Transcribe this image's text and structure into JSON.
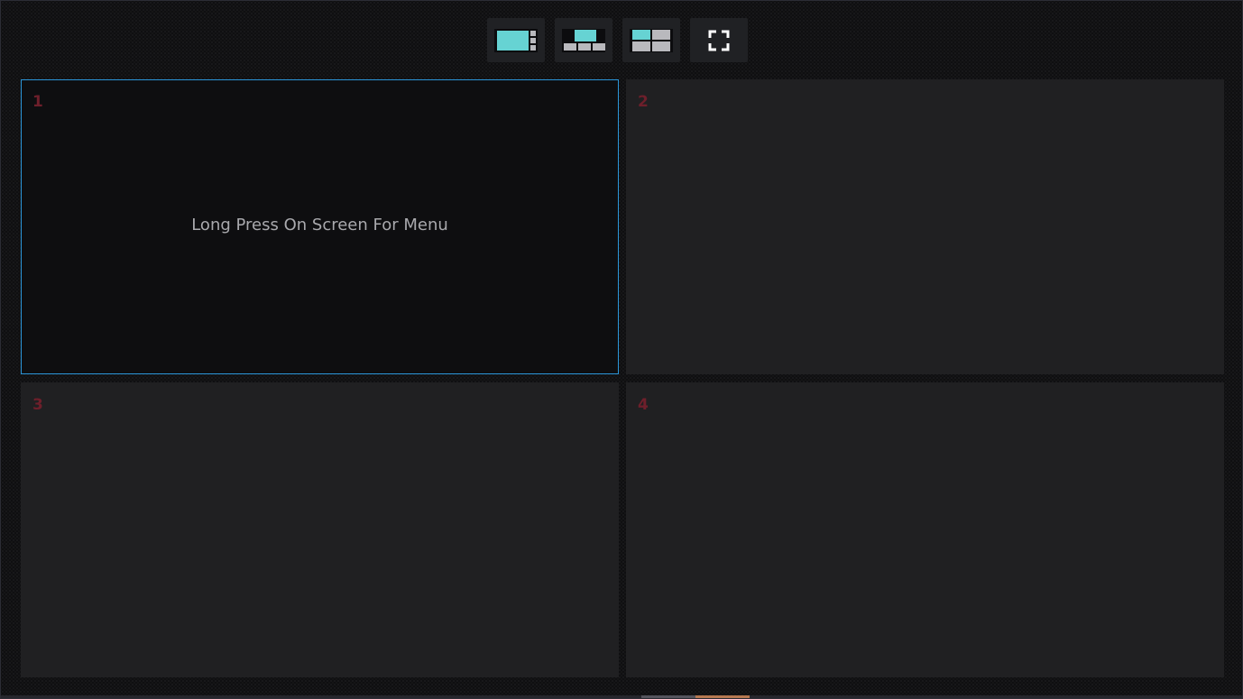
{
  "toolbar": {
    "buttons": [
      {
        "name": "layout-main-side-button",
        "icon": "layout-main-side-icon"
      },
      {
        "name": "layout-top-bottom-button",
        "icon": "layout-top-bottom-icon"
      },
      {
        "name": "layout-quad-button",
        "icon": "layout-quad-icon"
      },
      {
        "name": "fullscreen-button",
        "icon": "fullscreen-icon"
      }
    ]
  },
  "panes": [
    {
      "number": "1",
      "active": true,
      "hint": "Long Press On Screen For Menu"
    },
    {
      "number": "2",
      "active": false
    },
    {
      "number": "3",
      "active": false
    },
    {
      "number": "4",
      "active": false
    }
  ],
  "colors": {
    "accent": "#2b96d9",
    "icon_teal": "#66d3d3",
    "icon_gray": "#b9b9bd",
    "pane_number": "#6e1f2b",
    "pane_background": "#202022",
    "active_pane_background": "#0e0e10"
  }
}
